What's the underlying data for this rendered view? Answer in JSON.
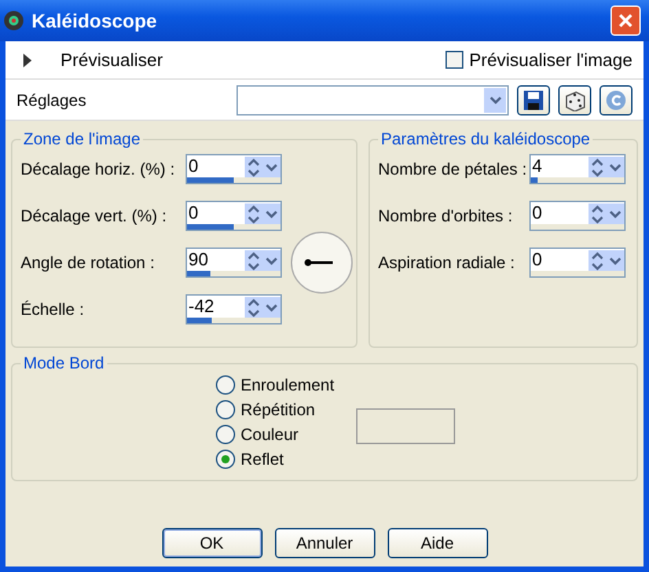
{
  "window": {
    "title": "Kaléidoscope"
  },
  "preview": {
    "label": "Prévisualiser",
    "expanded": false,
    "checkbox_label": "Prévisualiser l'image",
    "checked": false
  },
  "presets": {
    "label": "Réglages"
  },
  "image_zone": {
    "title": "Zone de l'image",
    "fields": [
      {
        "label": "Décalage horiz. (%) :",
        "value": "0",
        "level": 0.5
      },
      {
        "label": "Décalage vert. (%) :",
        "value": "0",
        "level": 0.5
      },
      {
        "label": "Angle de rotation :",
        "value": "90",
        "level": 0.25
      },
      {
        "label": "Échelle :",
        "value": "-42",
        "level": 0.27
      }
    ]
  },
  "kaleidoscope": {
    "title": "Paramètres du kaléidoscope",
    "fields": [
      {
        "label": "Nombre de pétales :",
        "value": "4",
        "level": 0.08
      },
      {
        "label": "Nombre d'orbites :",
        "value": "0"
      },
      {
        "label": "Aspiration radiale :",
        "value": "0"
      }
    ]
  },
  "edge_mode": {
    "title": "Mode Bord",
    "options": [
      {
        "label": "Enroulement",
        "selected": false
      },
      {
        "label": "Répétition",
        "selected": false
      },
      {
        "label": "Couleur",
        "selected": false
      },
      {
        "label": "Reflet",
        "selected": true
      }
    ],
    "color": "#ece9d8"
  },
  "buttons": [
    {
      "label": "OK",
      "default": true
    },
    {
      "label": "Annuler",
      "default": false
    },
    {
      "label": "Aide",
      "default": false
    }
  ]
}
